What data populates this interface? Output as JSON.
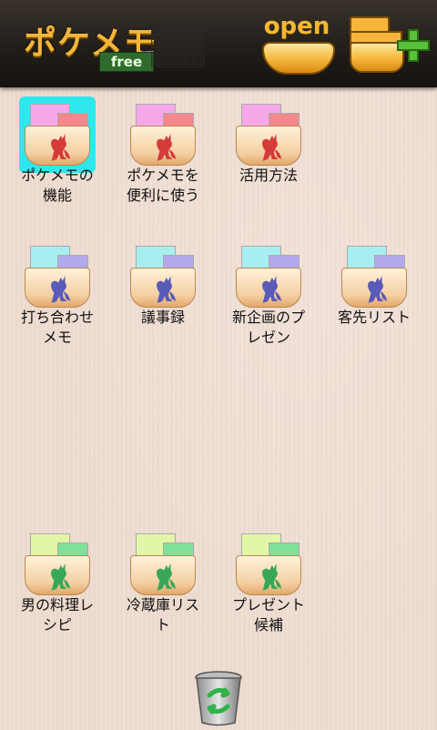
{
  "header": {
    "app_title": "ポケメモ",
    "edition": "free",
    "open_label": "open",
    "open_icon": "open-folder-icon",
    "new_folder_icon": "new-folder-plus-icon"
  },
  "folders": [
    {
      "label": "ポケメモの\n機能",
      "color": "red",
      "selected": true
    },
    {
      "label": "ポケメモを\n便利に使う",
      "color": "red",
      "selected": false
    },
    {
      "label": "活用方法",
      "color": "red",
      "selected": false
    },
    {
      "label": "打ち合わせ\nメモ",
      "color": "blue",
      "selected": false
    },
    {
      "label": "議事録",
      "color": "blue",
      "selected": false
    },
    {
      "label": "新企画のプ\nレゼン",
      "color": "blue",
      "selected": false
    },
    {
      "label": "客先リスト",
      "color": "blue",
      "selected": false
    },
    {
      "label": "男の料理レ\nシピ",
      "color": "green",
      "selected": false
    },
    {
      "label": "冷蔵庫リス\nト",
      "color": "green",
      "selected": false
    },
    {
      "label": "プレゼント\n候補",
      "color": "green",
      "selected": false
    }
  ],
  "themes": {
    "red": {
      "paper1": "#f7a8e8",
      "paper2": "#f4888a",
      "kangaroo": "#d43b3b"
    },
    "blue": {
      "paper1": "#a8eef0",
      "paper2": "#b4a8ec",
      "kangaroo": "#5a5ab8"
    },
    "green": {
      "paper1": "#e2f7a6",
      "paper2": "#7fe09a",
      "kangaroo": "#38a858"
    }
  },
  "footer": {
    "trash_icon": "recycle-bin-icon"
  }
}
